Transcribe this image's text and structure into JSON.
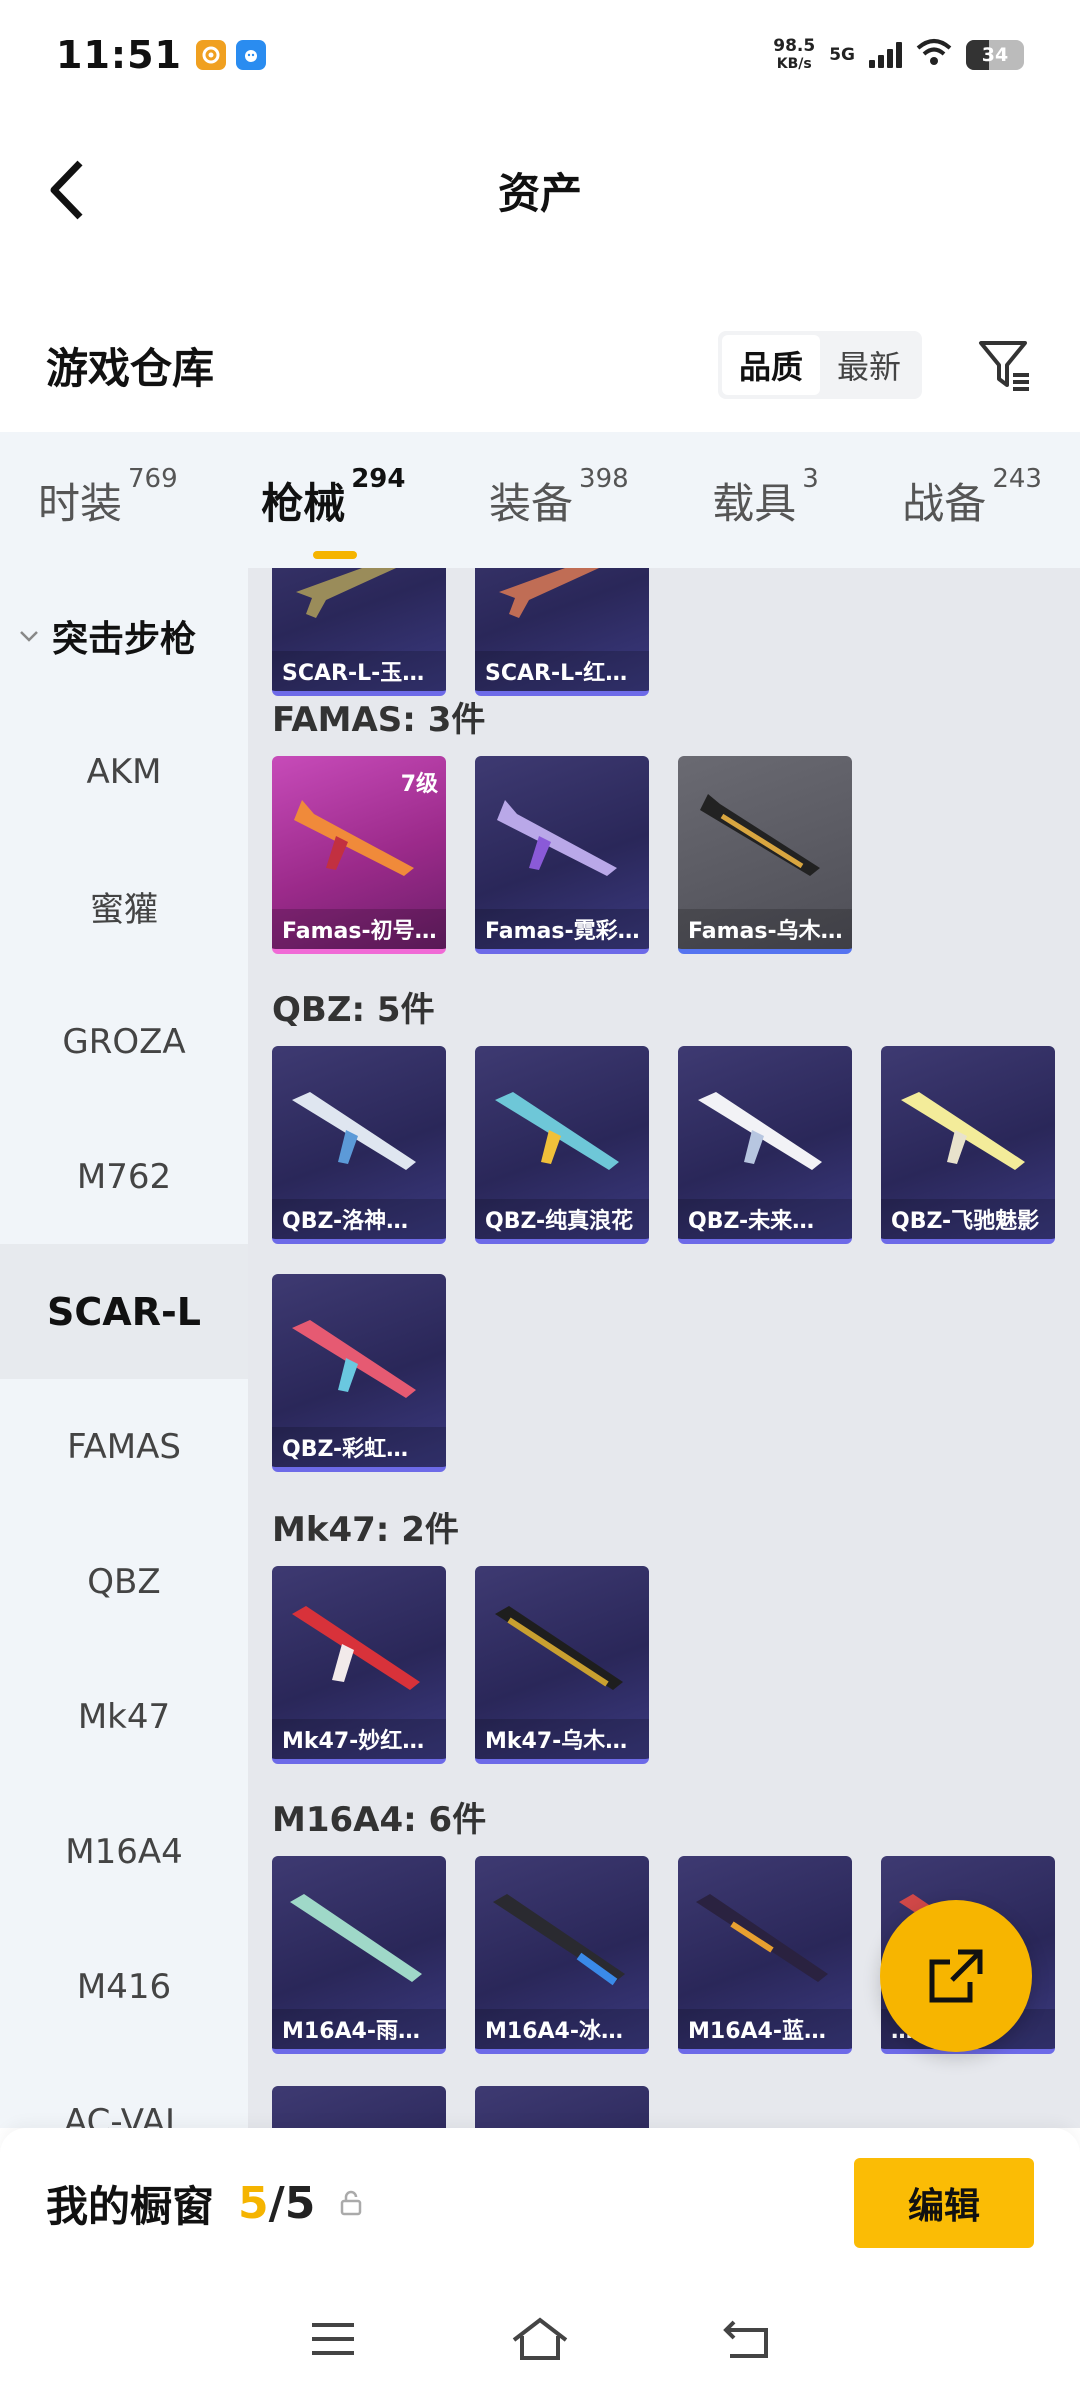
{
  "status_bar": {
    "time": "11:51",
    "speed_value": "98.5",
    "speed_unit": "KB/s",
    "network": "5G",
    "battery": "34"
  },
  "header": {
    "title": "资产"
  },
  "warehouse": {
    "label": "游戏仓库",
    "sort_options": [
      "品质",
      "最新"
    ],
    "sort_selected": "品质"
  },
  "tabs": [
    {
      "label": "时装",
      "count": "769"
    },
    {
      "label": "枪械",
      "count": "294"
    },
    {
      "label": "装备",
      "count": "398"
    },
    {
      "label": "载具",
      "count": "3"
    },
    {
      "label": "战备",
      "count": "243"
    }
  ],
  "active_tab": "枪械",
  "sidebar": {
    "group": "突击步枪",
    "items": [
      "AKM",
      "蜜獾",
      "GROZA",
      "M762",
      "SCAR-L",
      "FAMAS",
      "QBZ",
      "Mk47",
      "M16A4",
      "M416",
      "AC-VAL"
    ],
    "selected": "SCAR-L"
  },
  "sections": [
    {
      "title": "",
      "items": [
        {
          "name": "SCAR-L-玉…"
        },
        {
          "name": "SCAR-L-红…"
        }
      ]
    },
    {
      "title": "FAMAS: 3件",
      "items": [
        {
          "name": "Famas-初号…",
          "level": "7级"
        },
        {
          "name": "Famas-霓彩…"
        },
        {
          "name": "Famas-乌木…"
        }
      ]
    },
    {
      "title": "QBZ: 5件",
      "items": [
        {
          "name": "QBZ-洛神…"
        },
        {
          "name": "QBZ-纯真浪花"
        },
        {
          "name": "QBZ-未来…"
        },
        {
          "name": "QBZ-飞驰魅影"
        },
        {
          "name": "QBZ-彩虹…"
        }
      ]
    },
    {
      "title": "Mk47: 2件",
      "items": [
        {
          "name": "Mk47-妙红…"
        },
        {
          "name": "Mk47-乌木…"
        }
      ]
    },
    {
      "title": "M16A4: 6件",
      "items": [
        {
          "name": "M16A4-雨…"
        },
        {
          "name": "M16A4-冰…"
        },
        {
          "name": "M16A4-蓝…"
        },
        {
          "name": "…红…"
        }
      ]
    }
  ],
  "showcase": {
    "label": "我的橱窗",
    "current": "5",
    "separator": "/",
    "total": "5",
    "edit_label": "编辑"
  },
  "colors": {
    "accent": "#f5b400",
    "card_bg": "#2f2b63",
    "legend_card": "#b33aa6",
    "page_bg": "#e6e8ed"
  }
}
